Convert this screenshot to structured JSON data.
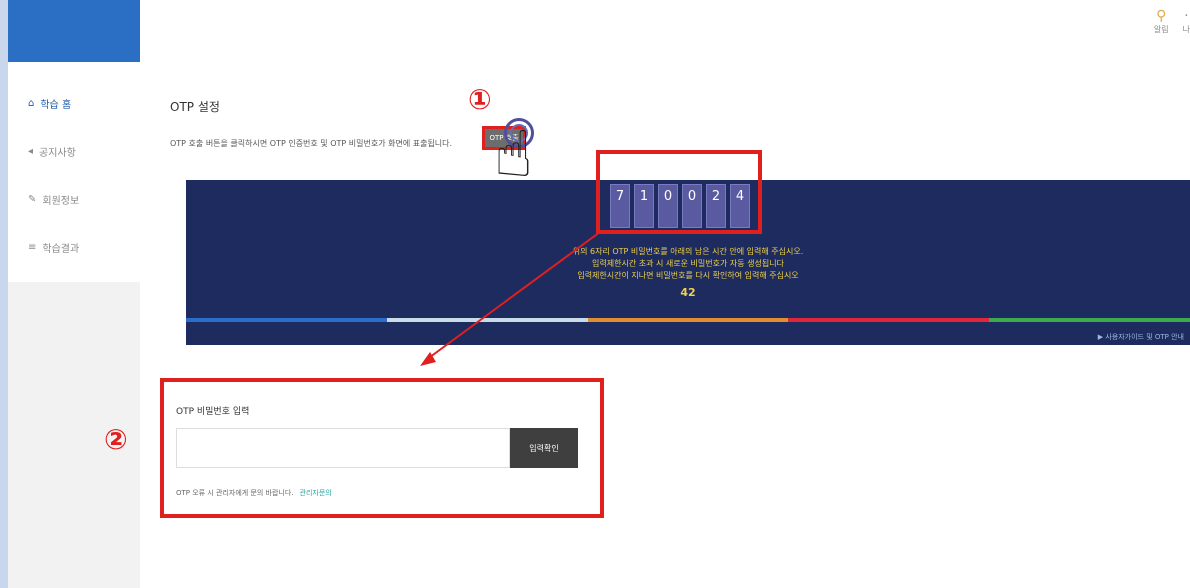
{
  "topbar": {
    "items": [
      {
        "label": "알림"
      },
      {
        "label": "나"
      }
    ]
  },
  "sidebar": {
    "items": [
      {
        "label": "학습 홈"
      },
      {
        "label": "공지사항"
      },
      {
        "label": "회원정보"
      },
      {
        "label": "학습결과"
      }
    ]
  },
  "otp": {
    "title": "OTP 설정",
    "description": "OTP 호출 버튼을 클릭하시면 OTP 인증번호 및 OTP 비밀번호가 화면에 표출됩니다.",
    "call_button_label": "OTP 호출",
    "digits": [
      "7",
      "1",
      "0",
      "0",
      "2",
      "4"
    ],
    "message_lines": [
      "위의 6자리 OTP 비밀번호를 아래의 남은 시간 안에 입력해 주십시오.",
      "입력제한시간 초과 시 새로운 비밀번호가 자동 생성됩니다",
      "입력제한시간이 지나면 비밀번호를 다시 확인하여 입력해 주십시오"
    ],
    "countdown": "42",
    "banner_link": "▶ 사용자가이드 및 OTP 안내"
  },
  "annotations": {
    "step1": "①",
    "step2": "②"
  },
  "form": {
    "title": "OTP 비밀번호 입력",
    "input_value": "",
    "confirm_label": "입력확인",
    "note": "OTP 오류 시 관리자에게 문의 바랍니다.",
    "note_link": "관리자문의"
  },
  "colors": {
    "highlight": "#e0201f",
    "banner_bg": "#1d2b5e",
    "brand": "#2a6fc4",
    "stripes": [
      "#2b6ec9",
      "#c7dce8",
      "#e09030",
      "#e0263a",
      "#3aaa4a"
    ]
  }
}
